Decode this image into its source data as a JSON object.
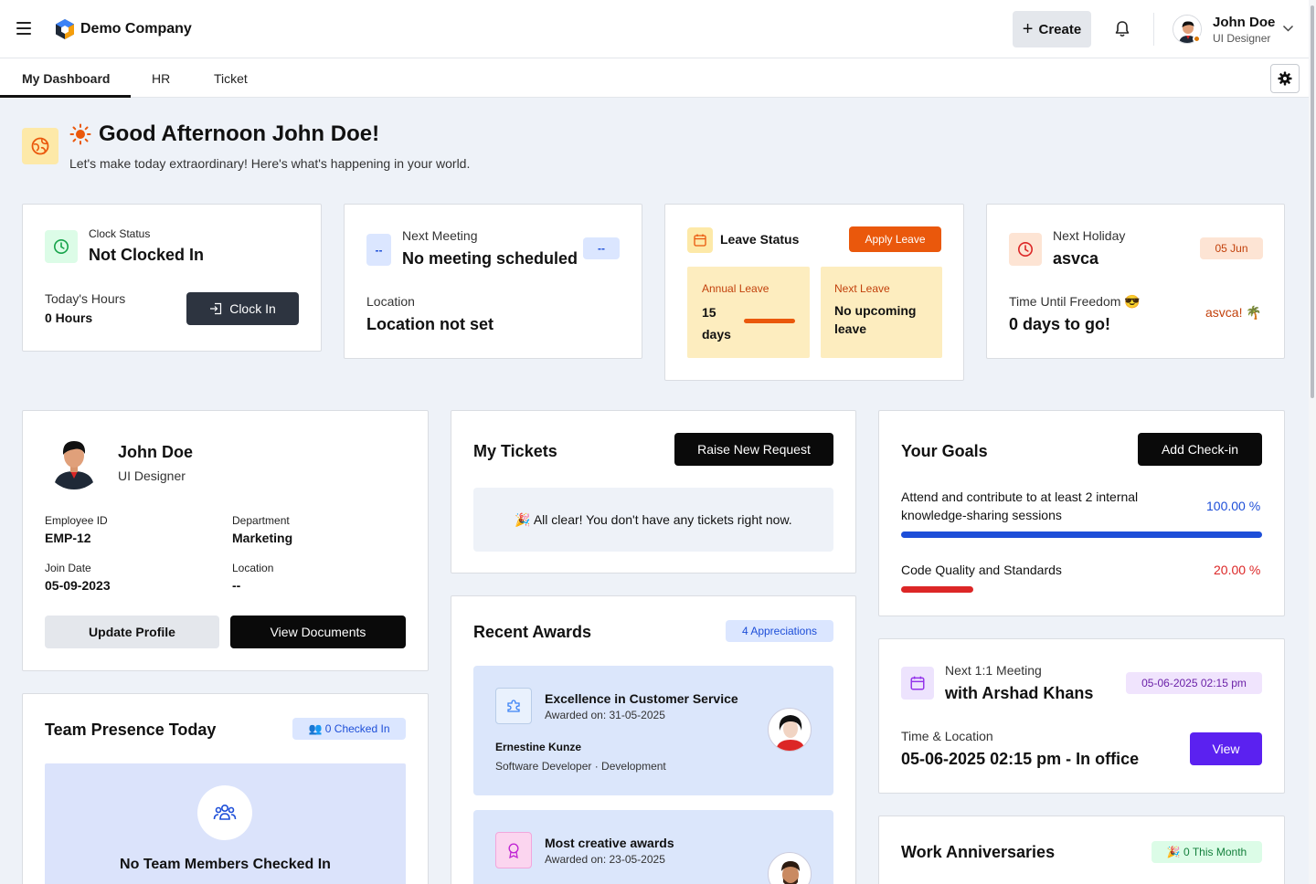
{
  "header": {
    "company": "Demo Company",
    "create_label": "Create",
    "user_name": "John Doe",
    "user_role": "UI Designer"
  },
  "tabs": [
    {
      "label": "My Dashboard",
      "active": true
    },
    {
      "label": "HR",
      "active": false
    },
    {
      "label": "Ticket",
      "active": false
    }
  ],
  "greeting": {
    "title": "Good Afternoon John Doe!",
    "subtitle": "Let's make today extraordinary! Here's what's happening in your world."
  },
  "clock": {
    "label": "Clock Status",
    "status": "Not Clocked In",
    "hours_label": "Today's Hours",
    "hours_value": "0 Hours",
    "button": "Clock In"
  },
  "meeting": {
    "icon_text": "--",
    "label": "Next Meeting",
    "value": "No meeting scheduled",
    "badge": "--",
    "location_label": "Location",
    "location_value": "Location not set"
  },
  "leave": {
    "title": "Leave Status",
    "apply": "Apply Leave",
    "annual_label": "Annual Leave",
    "annual_value": "15 days",
    "next_label": "Next Leave",
    "next_value": "No upcoming leave"
  },
  "holiday": {
    "label": "Next Holiday",
    "name": "asvca",
    "date": "05 Jun",
    "until_label": "Time Until Freedom",
    "until_emoji": "😎",
    "until_value": "0 days to go!",
    "tag": "asvca!",
    "tag_emoji": "🌴"
  },
  "profile": {
    "name": "John Doe",
    "role": "UI Designer",
    "emp_id_label": "Employee ID",
    "emp_id": "EMP-12",
    "dept_label": "Department",
    "dept": "Marketing",
    "join_label": "Join Date",
    "join": "05-09-2023",
    "loc_label": "Location",
    "loc": "--",
    "update_btn": "Update Profile",
    "docs_btn": "View Documents"
  },
  "team": {
    "title": "Team Presence Today",
    "badge": "👥 0 Checked In",
    "empty": "No Team Members Checked In"
  },
  "tickets": {
    "title": "My Tickets",
    "button": "Raise New Request",
    "empty": "🎉 All clear! You don't have any tickets right now."
  },
  "awards": {
    "title": "Recent Awards",
    "badge": "4 Appreciations",
    "items": [
      {
        "title": "Excellence in Customer Service",
        "date": "Awarded on: 31-05-2025",
        "person": "Ernestine Kunze",
        "meta": "Software Developer · Development"
      },
      {
        "title": "Most creative awards",
        "date": "Awarded on: 23-05-2025"
      }
    ]
  },
  "goals": {
    "title": "Your Goals",
    "button": "Add Check-in",
    "items": [
      {
        "name": "Attend and contribute to at least 2 internal knowledge-sharing sessions",
        "pct_label": "100.00 %",
        "progress": 1.0,
        "color": "#1d4ed8"
      },
      {
        "name": "Code Quality and Standards",
        "pct_label": "20.00 %",
        "progress": 0.2,
        "color": "#dc2626"
      }
    ]
  },
  "one_on_one": {
    "label": "Next 1:1 Meeting",
    "with": "with Arshad Khans",
    "badge": "05-06-2025 02:15 pm",
    "tl_label": "Time & Location",
    "tl_value": "05-06-2025 02:15 pm - In office",
    "button": "View"
  },
  "anniversaries": {
    "title": "Work Anniversaries",
    "badge": "🎉 0 This Month"
  },
  "colors": {
    "orange": "#ea580c",
    "purple": "#5b21f0",
    "blue_badge": "#dbe6ff"
  }
}
